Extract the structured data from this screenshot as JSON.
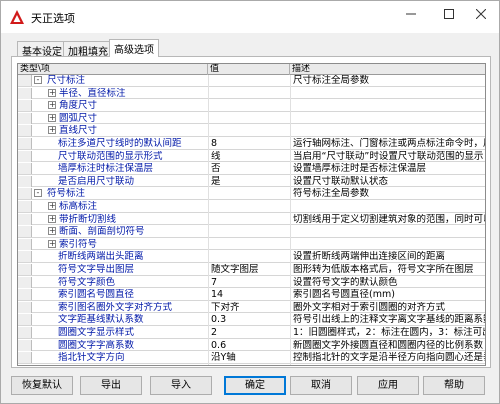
{
  "window": {
    "title": "天正选项"
  },
  "tabs": [
    {
      "label": "基本设定"
    },
    {
      "label": "加粗填充"
    },
    {
      "label": "高级选项"
    }
  ],
  "grid": {
    "headers": [
      "类型\\项",
      "值",
      "描述"
    ],
    "rows": [
      {
        "level": 0,
        "expander": "-",
        "label": "尺寸标注",
        "value": "",
        "desc": "尺寸标注全局参数"
      },
      {
        "level": 1,
        "expander": "+",
        "label": "半径、直径标注",
        "value": "",
        "desc": ""
      },
      {
        "level": 1,
        "expander": "+",
        "label": "角度尺寸",
        "value": "",
        "desc": ""
      },
      {
        "level": 1,
        "expander": "+",
        "label": "圆弧尺寸",
        "value": "",
        "desc": ""
      },
      {
        "level": 1,
        "expander": "+",
        "label": "直线尺寸",
        "value": "",
        "desc": ""
      },
      {
        "level": 1,
        "expander": "",
        "label": "标注多道尺寸线时的默认间距",
        "value": "8",
        "desc": "运行轴网标注、门窗标注或两点标注命令时，用"
      },
      {
        "level": 1,
        "expander": "",
        "label": "尺寸联动范围的显示形式",
        "value": "线",
        "desc": "当启用“尺寸联动”时设置尺寸联动范围的显示"
      },
      {
        "level": 1,
        "expander": "",
        "label": "墙厚标注时标注保温层",
        "value": "否",
        "desc": "设置墙厚标注时是否标注保温层"
      },
      {
        "level": 1,
        "expander": "",
        "label": "是否启用尺寸联动",
        "value": "是",
        "desc": "设置尺寸联动默认状态"
      },
      {
        "level": 0,
        "expander": "-",
        "label": "符号标注",
        "value": "",
        "desc": "符号标注全局参数"
      },
      {
        "level": 1,
        "expander": "+",
        "label": "标高标注",
        "value": "",
        "desc": ""
      },
      {
        "level": 1,
        "expander": "+",
        "label": "带折断切割线",
        "value": "",
        "desc": "切割线用于定义切割建筑对象的范围，同时可以"
      },
      {
        "level": 1,
        "expander": "+",
        "label": "断面、剖面剖切符号",
        "value": "",
        "desc": ""
      },
      {
        "level": 1,
        "expander": "+",
        "label": "索引符号",
        "value": "",
        "desc": ""
      },
      {
        "level": 1,
        "expander": "",
        "label": "折断线两端出头距离",
        "value": "",
        "desc": "设置折断线两端伸出连接区间的距离"
      },
      {
        "level": 1,
        "expander": "",
        "label": "符号文字导出图层",
        "value": "随文字图层",
        "desc": "图形转为低版本格式后，符号文字所在图层"
      },
      {
        "level": 1,
        "expander": "",
        "label": "符号文字颜色",
        "value": "7",
        "desc": "设置符号文字的默认颜色"
      },
      {
        "level": 1,
        "expander": "",
        "label": "索引圆名号圆直径",
        "value": "14",
        "desc": "索引圆名号圆直径(mm)"
      },
      {
        "level": 1,
        "expander": "",
        "label": "索引图名圈外文字对齐方式",
        "value": "下对齐",
        "desc": "圈外文字相对于索引圆圈的对齐方式"
      },
      {
        "level": 1,
        "expander": "",
        "label": "文字距基线默认系数",
        "value": "0.3",
        "desc": "符号引出线上的注释文字离文字基线的距离系数"
      },
      {
        "level": 1,
        "expander": "",
        "label": "圆圈文字显示样式",
        "value": "2",
        "desc": "1：旧圆圈样式，2：标注在圆内，3：标注可出圈，作"
      },
      {
        "level": 1,
        "expander": "",
        "label": "圆圈文字字高系数",
        "value": "0.6",
        "desc": "新圆圈文字外接圆直径和圆圈内径的比例系数"
      },
      {
        "level": 1,
        "expander": "",
        "label": "指北针文字方向",
        "value": "沿Y轴",
        "desc": "控制指北针的文字是沿半径方向指向圆心还是垂"
      }
    ]
  },
  "buttons": {
    "restore": "恢复默认",
    "export": "导出",
    "import": "导入",
    "ok": "确定",
    "cancel": "取消",
    "apply": "应用",
    "help": "帮助"
  },
  "colors": {
    "accent": "#0078d7",
    "category_text": "#0018a8",
    "app_icon": "#d11a1a"
  }
}
